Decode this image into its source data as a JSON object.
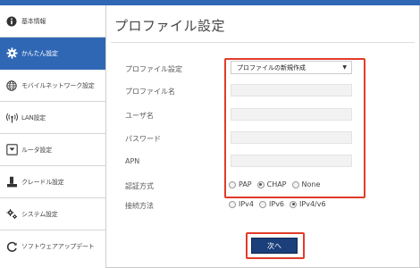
{
  "sidebar": {
    "items": [
      {
        "label": "基本情報",
        "icon": "info-icon"
      },
      {
        "label": "かんたん設定",
        "icon": "gear-icon",
        "active": true
      },
      {
        "label": "モバイルネットワーク設定",
        "icon": "globe-icon"
      },
      {
        "label": "LAN設定",
        "icon": "antenna-icon"
      },
      {
        "label": "ルータ設定",
        "icon": "router-icon"
      },
      {
        "label": "クレードル設定",
        "icon": "cradle-icon"
      },
      {
        "label": "システム設定",
        "icon": "cogs-icon"
      },
      {
        "label": "ソフトウェアアップデート",
        "icon": "refresh-icon"
      }
    ]
  },
  "main": {
    "title": "プロファイル設定",
    "form": {
      "profile_label": "プロファイル設定",
      "profile_selected": "プロファイルの新規作成",
      "profile_name_label": "プロファイル名",
      "profile_name_value": "",
      "user_label": "ユーザ名",
      "user_value": "",
      "password_label": "パスワード",
      "password_value": "",
      "apn_label": "APN",
      "apn_value": "",
      "auth_label": "認証方式",
      "auth_options": [
        "PAP",
        "CHAP",
        "None"
      ],
      "auth_selected": "CHAP",
      "conn_label": "接続方法",
      "conn_options": [
        "IPv4",
        "IPv6",
        "IPv4/v6"
      ],
      "conn_selected": "IPv4/v6"
    },
    "next_label": "次へ"
  },
  "colors": {
    "accent": "#2f67b5",
    "highlight": "#e23b2a",
    "button": "#1b3f7a"
  }
}
